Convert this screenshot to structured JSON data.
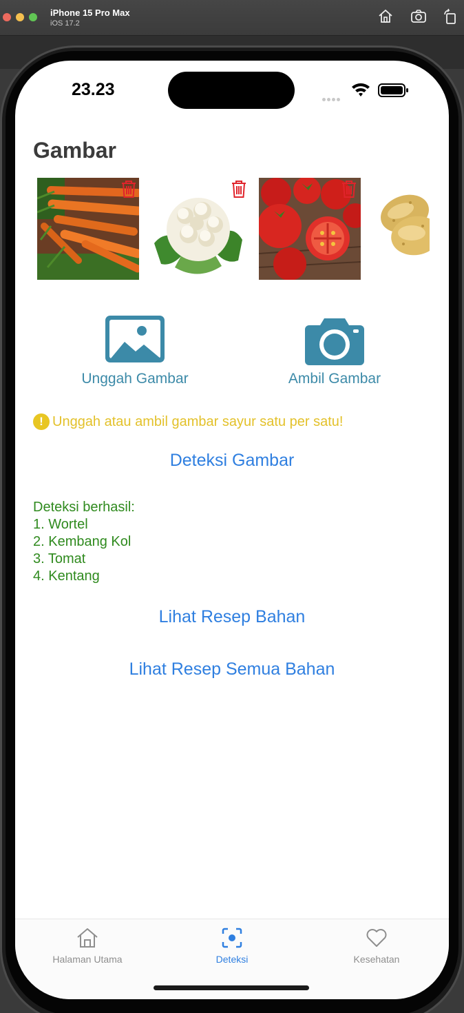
{
  "simulator": {
    "device_name": "iPhone 15 Pro Max",
    "os_version": "iOS 17.2",
    "tools": [
      "home-icon",
      "screenshot-icon",
      "rotate-icon"
    ]
  },
  "status_bar": {
    "time": "23.23",
    "icons": [
      "signal-icon",
      "wifi-icon",
      "battery-icon"
    ]
  },
  "page": {
    "section_title": "Gambar",
    "images": [
      {
        "name": "carrots-image",
        "icon": "trash-icon"
      },
      {
        "name": "cauliflower-image",
        "icon": "trash-icon"
      },
      {
        "name": "tomatoes-image",
        "icon": "trash-icon"
      },
      {
        "name": "potatoes-image",
        "icon": "trash-icon"
      }
    ],
    "upload_label": "Unggah Gambar",
    "capture_label": "Ambil Gambar",
    "warning_icon_text": "!",
    "warning_text": "Unggah atau ambil gambar sayur satu per satu!",
    "detect_label": "Deteksi Gambar",
    "result_heading": "Deteksi berhasil:",
    "results": [
      "1. Wortel",
      "2. Kembang Kol",
      "3. Tomat",
      "4. Kentang"
    ],
    "view_recipe_label": "Lihat Resep Bahan",
    "view_all_recipe_label": "Lihat Resep Semua Bahan"
  },
  "tabbar": {
    "tabs": [
      {
        "label": "Halaman Utama",
        "icon": "home-icon"
      },
      {
        "label": "Deteksi",
        "icon": "scan-icon"
      },
      {
        "label": "Kesehatan",
        "icon": "heart-icon"
      }
    ],
    "active_color": "#2f7fe0",
    "inactive_color": "#8e8e8e"
  },
  "colors": {
    "accent": "#2f7fe0",
    "teal": "#3c8aa8",
    "warning": "#e3c12a",
    "success": "#2f8a1e",
    "delete": "#e0242b"
  }
}
